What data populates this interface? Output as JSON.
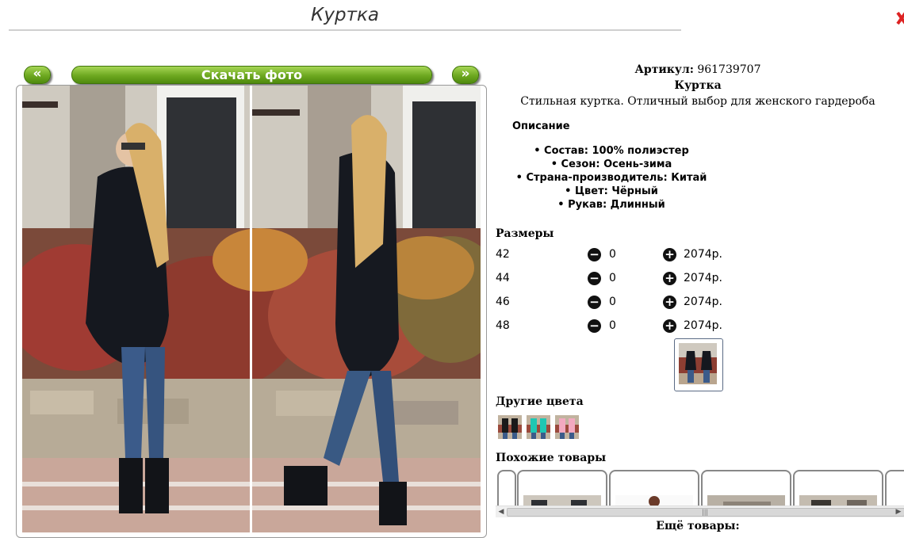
{
  "page": {
    "title": "Куртка"
  },
  "gallery": {
    "prev_label": "«",
    "next_label": "»",
    "download_label": "Скачать фото"
  },
  "product": {
    "article_label": "Артикул:",
    "article_value": "961739707",
    "name": "Куртка",
    "tagline": "Стильная куртка. Отличный выбор для женского гардероба",
    "description_heading": "Описание",
    "attributes": [
      "• Состав: 100% полиэстер",
      "• Сезон: Осень-зима",
      "• Страна-производитель: Китай",
      "• Цвет: Чёрный",
      "• Рукав: Длинный"
    ]
  },
  "sizes": {
    "heading": "Размеры",
    "minus_symbol": "−",
    "plus_symbol": "+",
    "rows": [
      {
        "size": "42",
        "qty": "0",
        "price": "2074р."
      },
      {
        "size": "44",
        "qty": "0",
        "price": "2074р."
      },
      {
        "size": "46",
        "qty": "0",
        "price": "2074р."
      },
      {
        "size": "48",
        "qty": "0",
        "price": "2074р."
      }
    ]
  },
  "other_colors": {
    "heading": "Другие цвета",
    "swatches": [
      "#1a1a1a",
      "#1fc7b3",
      "#f3a9c0"
    ]
  },
  "similar": {
    "heading": "Похожие товары"
  },
  "more_label": "Ещё товары:",
  "colors": {
    "accent_green": "#6da820",
    "jacket": "#15181f"
  }
}
